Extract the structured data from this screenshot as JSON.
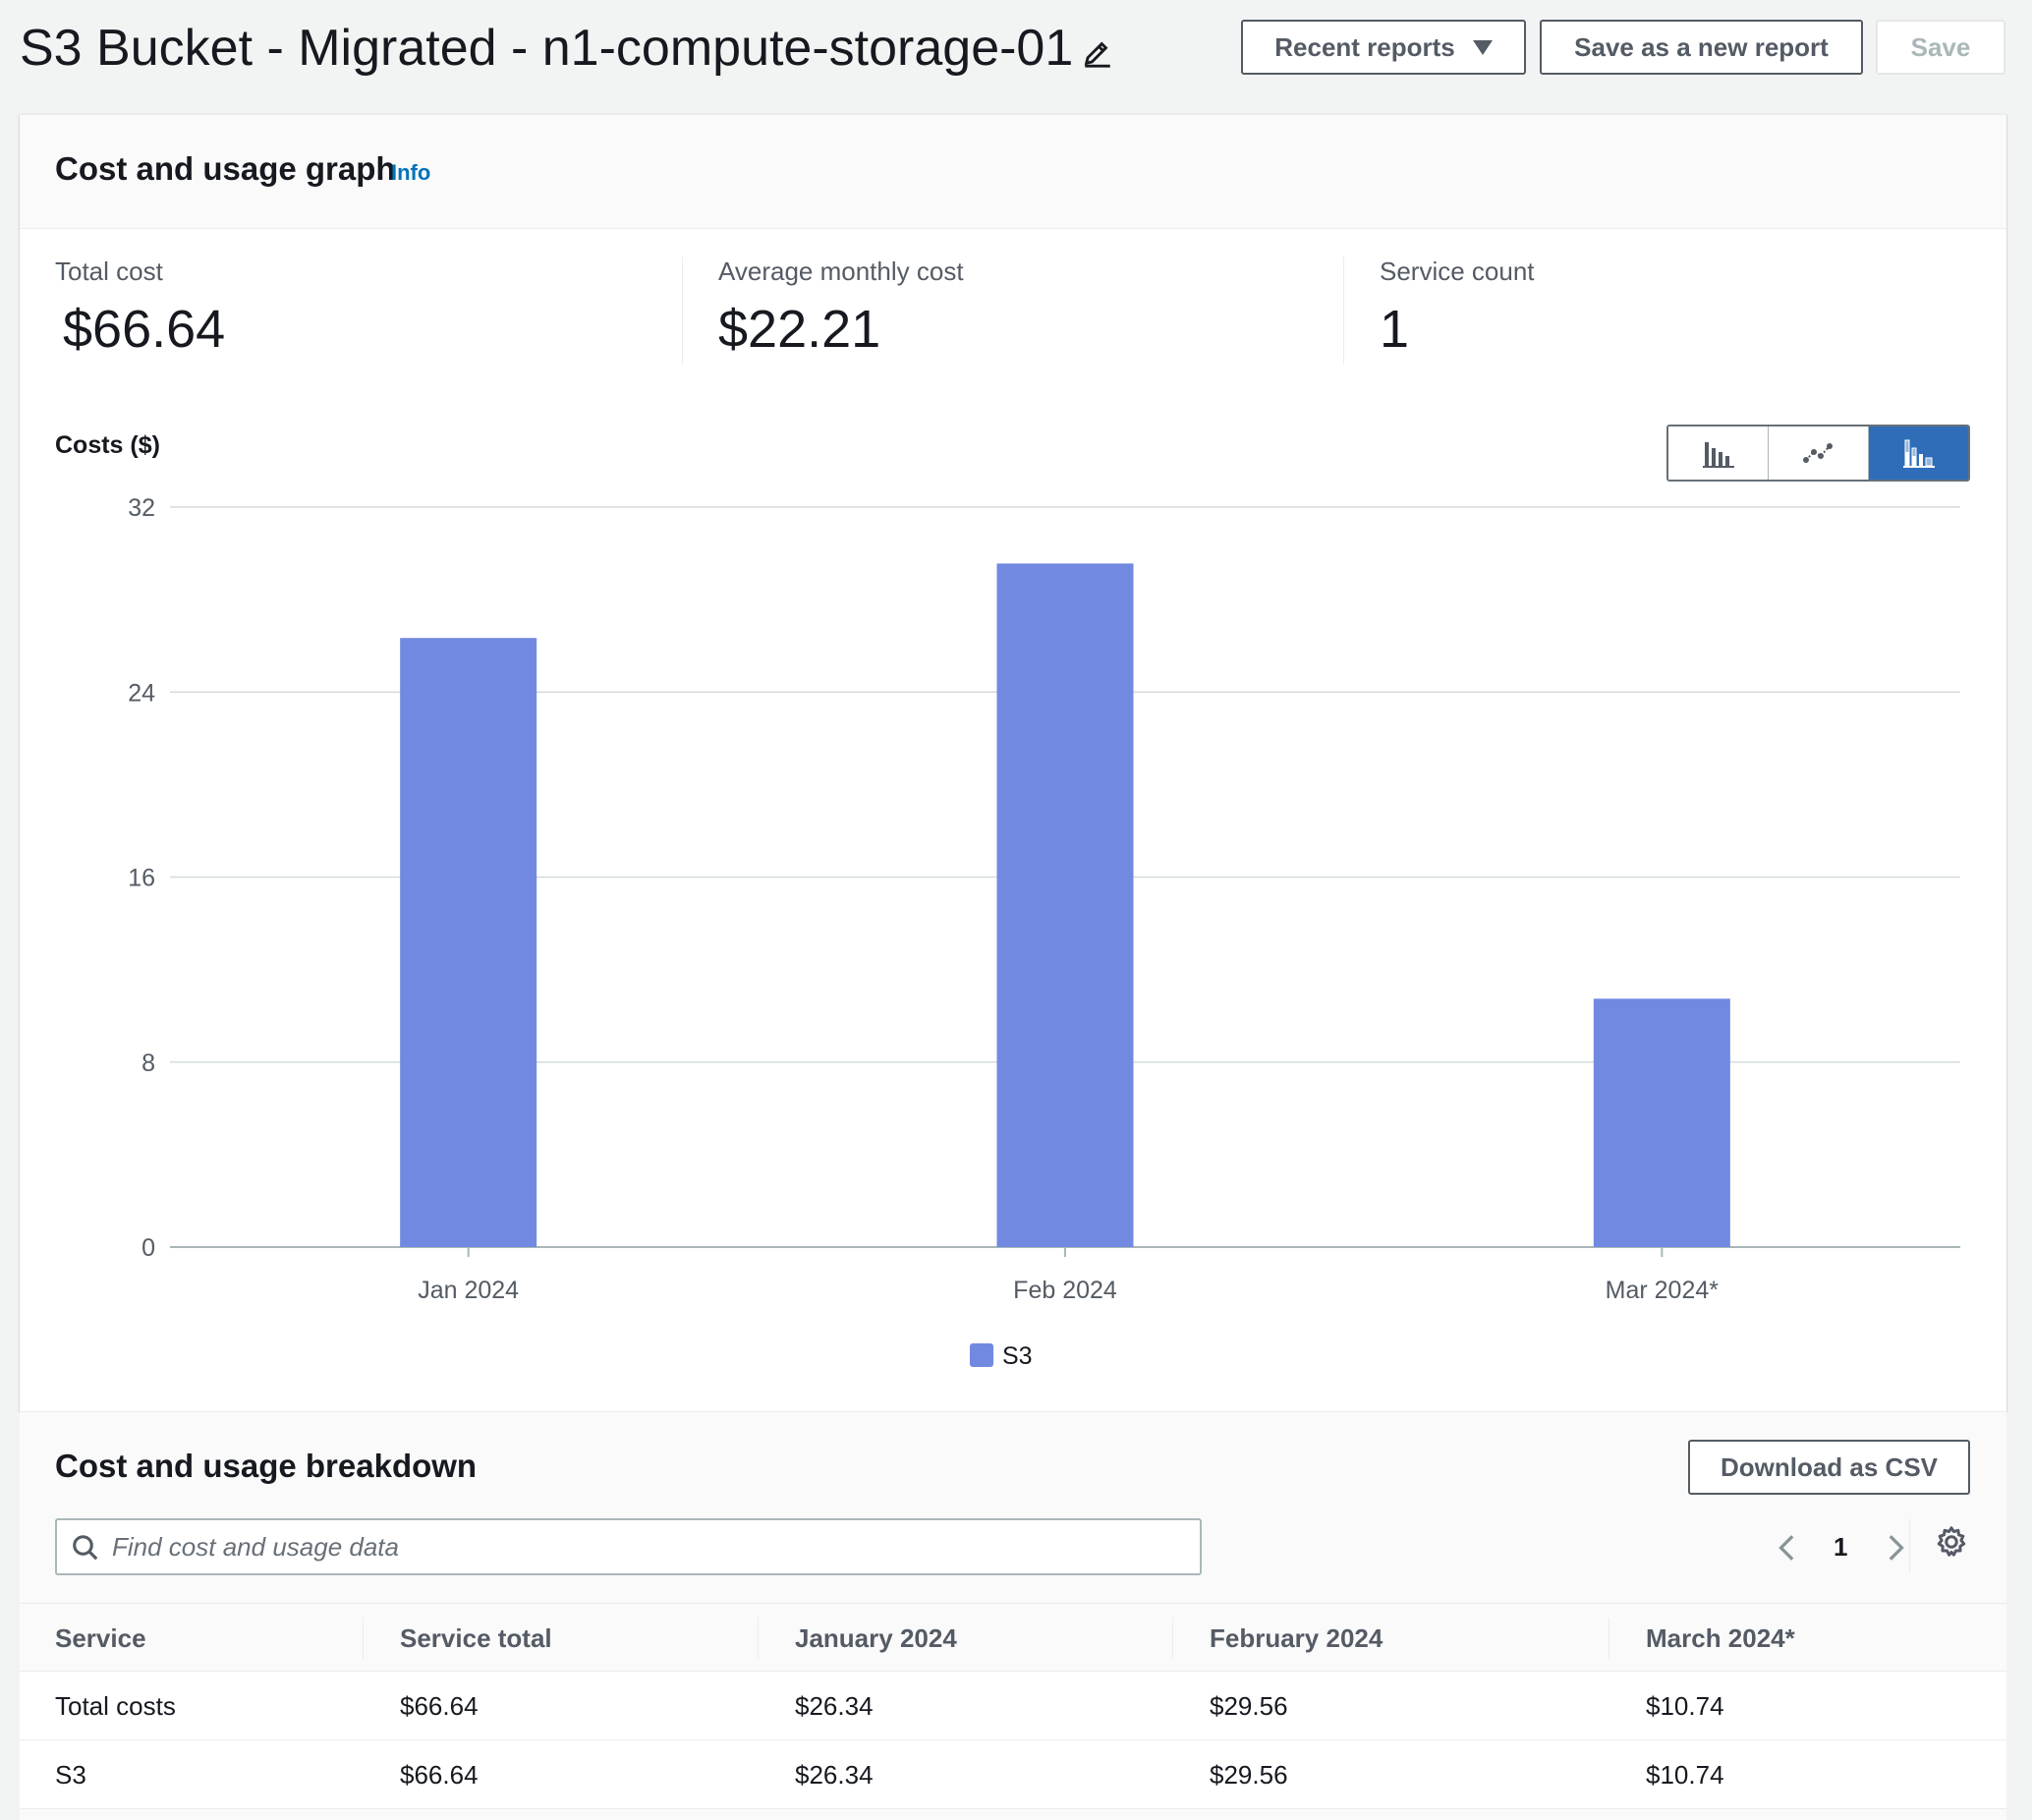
{
  "header": {
    "title": "S3 Bucket - Migrated - n1-compute-storage-01",
    "recent_reports_label": "Recent reports",
    "save_new_label": "Save as a new report",
    "save_label": "Save"
  },
  "graph_panel": {
    "title": "Cost and usage graph",
    "info_label": "Info",
    "metrics": [
      {
        "label": "Total cost",
        "value": "$66.64"
      },
      {
        "label": "Average monthly cost",
        "value": "$22.21"
      },
      {
        "label": "Service count",
        "value": "1"
      }
    ],
    "costs_label": "Costs ($)",
    "chart_type_options": [
      "bar-chart-icon",
      "line-chart-icon",
      "stacked-bar-chart-icon"
    ],
    "active_chart_type": "stacked-bar-chart-icon"
  },
  "chart_data": {
    "type": "bar",
    "categories": [
      "Jan 2024",
      "Feb 2024",
      "Mar 2024*"
    ],
    "series": [
      {
        "name": "S3",
        "values": [
          26.34,
          29.56,
          10.74
        ],
        "color": "#7189e0"
      }
    ],
    "ylabel": "Costs ($)",
    "yticks": [
      0,
      8,
      16,
      24,
      32
    ],
    "ylim": [
      0,
      32
    ],
    "grid": true,
    "legend": "bottom-center"
  },
  "breakdown": {
    "title": "Cost and usage breakdown",
    "download_label": "Download as CSV",
    "search_placeholder": "Find cost and usage data",
    "page_number": "1",
    "columns": [
      "Service",
      "Service total",
      "January 2024",
      "February 2024",
      "March 2024*"
    ],
    "rows": [
      [
        "Total costs",
        "$66.64",
        "$26.34",
        "$29.56",
        "$10.74"
      ],
      [
        "S3",
        "$66.64",
        "$26.34",
        "$29.56",
        "$10.74"
      ]
    ]
  },
  "colors": {
    "accent": "#2f6db9",
    "bar": "#7189e0",
    "link": "#0073bb"
  }
}
